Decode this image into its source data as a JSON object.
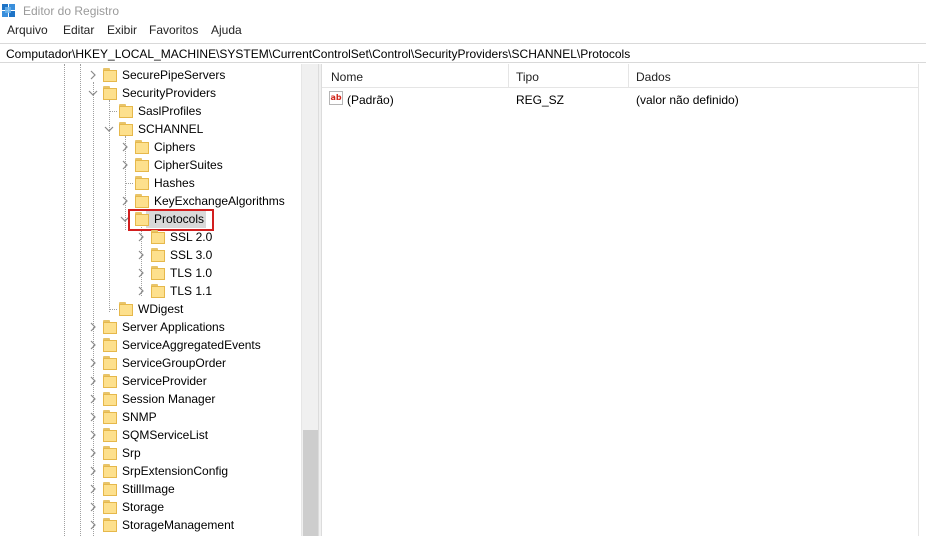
{
  "window": {
    "title": "Editor do Registro",
    "icon": "registry-editor-icon"
  },
  "menu": [
    "Arquivo",
    "Editar",
    "Exibir",
    "Favoritos",
    "Ajuda"
  ],
  "address": "Computador\\HKEY_LOCAL_MACHINE\\SYSTEM\\CurrentControlSet\\Control\\SecurityProviders\\SCHANNEL\\Protocols",
  "tree": {
    "nodes": [
      {
        "label": "SecurePipeServers",
        "chevron": "right"
      },
      {
        "label": "SecurityProviders",
        "chevron": "down"
      },
      {
        "label": "SaslProfiles",
        "chevron": "none"
      },
      {
        "label": "SCHANNEL",
        "chevron": "down"
      },
      {
        "label": "Ciphers",
        "chevron": "right"
      },
      {
        "label": "CipherSuites",
        "chevron": "right"
      },
      {
        "label": "Hashes",
        "chevron": "none"
      },
      {
        "label": "KeyExchangeAlgorithms",
        "chevron": "right"
      },
      {
        "label": "Protocols",
        "chevron": "down",
        "selected": true
      },
      {
        "label": "SSL 2.0",
        "chevron": "right"
      },
      {
        "label": "SSL 3.0",
        "chevron": "right"
      },
      {
        "label": "TLS 1.0",
        "chevron": "right"
      },
      {
        "label": "TLS 1.1",
        "chevron": "right"
      },
      {
        "label": "WDigest",
        "chevron": "none"
      },
      {
        "label": "Server Applications",
        "chevron": "right"
      },
      {
        "label": "ServiceAggregatedEvents",
        "chevron": "right"
      },
      {
        "label": "ServiceGroupOrder",
        "chevron": "right"
      },
      {
        "label": "ServiceProvider",
        "chevron": "right"
      },
      {
        "label": "Session Manager",
        "chevron": "right"
      },
      {
        "label": "SNMP",
        "chevron": "right"
      },
      {
        "label": "SQMServiceList",
        "chevron": "right"
      },
      {
        "label": "Srp",
        "chevron": "right"
      },
      {
        "label": "SrpExtensionConfig",
        "chevron": "right"
      },
      {
        "label": "StillImage",
        "chevron": "right"
      },
      {
        "label": "Storage",
        "chevron": "right"
      },
      {
        "label": "StorageManagement",
        "chevron": "right"
      }
    ]
  },
  "list": {
    "columns": [
      "Nome",
      "Tipo",
      "Dados"
    ],
    "rows": [
      {
        "name": "(Padrão)",
        "type": "REG_SZ",
        "data": "(valor não definido)",
        "icon": "string-value-icon"
      }
    ]
  },
  "colors": {
    "highlight_outline": "#d21f1f",
    "folder": "#fde08d",
    "selection": "#d9d9d9"
  }
}
